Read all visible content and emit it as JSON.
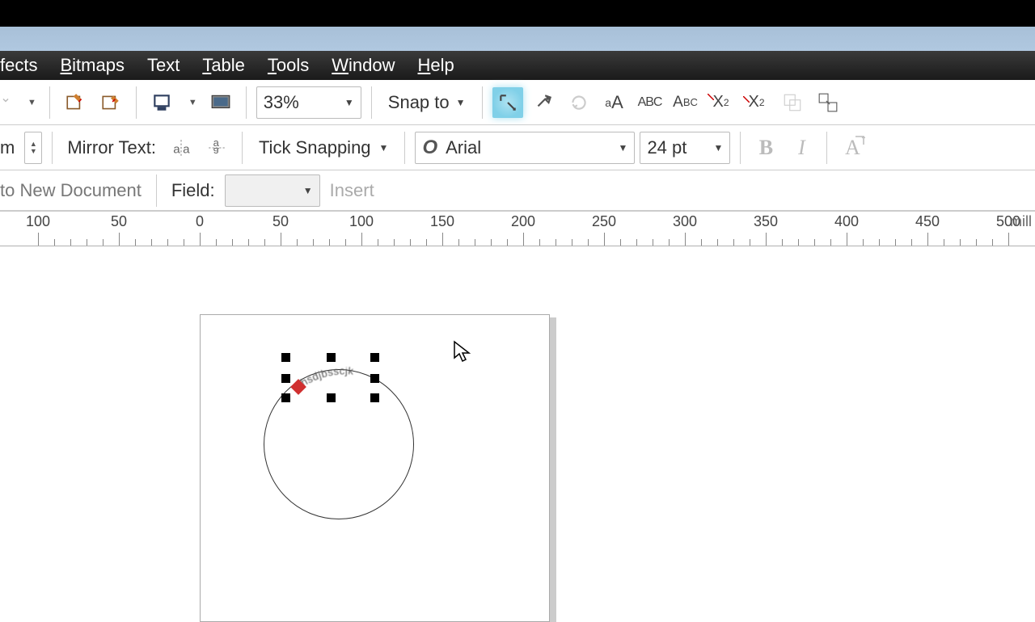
{
  "menu": {
    "effects": "fects",
    "bitmaps": "Bitmaps",
    "text": "Text",
    "table": "Table",
    "tools": "Tools",
    "window": "Window",
    "help": "Help"
  },
  "toolbar1": {
    "zoom": "33%",
    "snapto": "Snap to"
  },
  "toolbar2": {
    "mirror_label": "Mirror Text:",
    "tick_label": "Tick Snapping",
    "font": "Arial",
    "size": "24 pt"
  },
  "toolbar3": {
    "to_new_doc": "to New Document",
    "field_label": "Field:",
    "insert": "Insert"
  },
  "ruler": {
    "marks": [
      0,
      50,
      100,
      150,
      200,
      250,
      300,
      350,
      400,
      450
    ],
    "unit": "mill"
  },
  "canvas": {
    "curved_text": "ahsdjbsscjk"
  }
}
